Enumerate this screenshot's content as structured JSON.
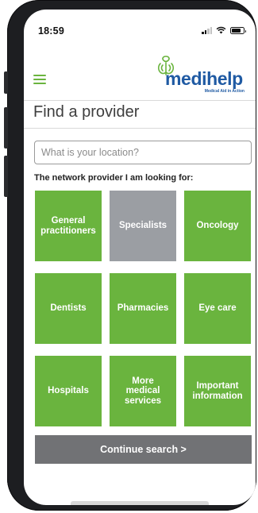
{
  "status_bar": {
    "time": "18:59",
    "signal_icon": "cellular-signal-icon",
    "wifi_icon": "wifi-icon",
    "battery_icon": "battery-icon",
    "battery_level": 0.8
  },
  "header": {
    "menu_icon": "hamburger-menu-icon",
    "logo": {
      "wordmark": "medihelp",
      "tagline": "Medical Aid in Action",
      "mark_icon": "medihelp-emblem-icon"
    }
  },
  "page": {
    "title": "Find a provider"
  },
  "search": {
    "placeholder": "What is your location?",
    "value": ""
  },
  "prompt": "The network provider I am looking for:",
  "providers": [
    {
      "label": "General practitioners",
      "selected": false
    },
    {
      "label": "Specialists",
      "selected": true
    },
    {
      "label": "Oncology",
      "selected": false
    },
    {
      "label": "Dentists",
      "selected": false
    },
    {
      "label": "Pharmacies",
      "selected": false
    },
    {
      "label": "Eye care",
      "selected": false
    },
    {
      "label": "Hospitals",
      "selected": false
    },
    {
      "label": "More medical services",
      "selected": false
    },
    {
      "label": "Important information",
      "selected": false
    }
  ],
  "continue_label": "Continue search >",
  "colors": {
    "accent_green": "#6ab43e",
    "selected_gray": "#9b9ea3",
    "button_gray": "#717275",
    "brand_blue": "#1f5aa3"
  }
}
